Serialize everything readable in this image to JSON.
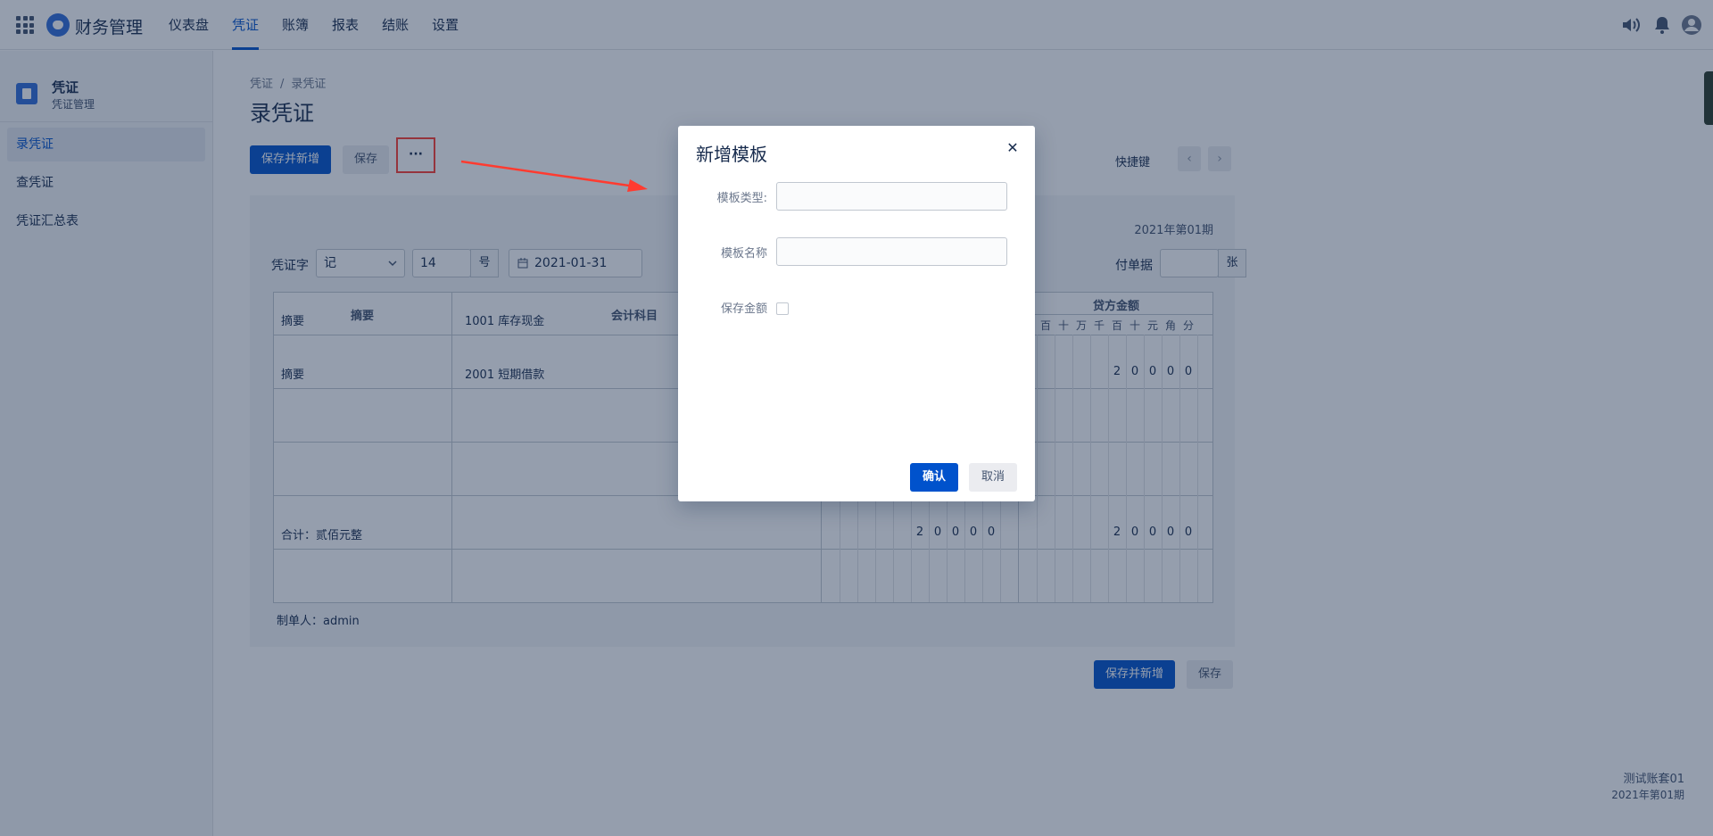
{
  "app": {
    "name": "财务管理"
  },
  "nav": {
    "items": [
      "仪表盘",
      "凭证",
      "账簿",
      "报表",
      "结账",
      "设置"
    ],
    "active": "凭证"
  },
  "sidebar": {
    "title": "凭证",
    "subtitle": "凭证管理",
    "items": [
      "录凭证",
      "查凭证",
      "凭证汇总表"
    ],
    "active": "录凭证"
  },
  "breadcrumb": {
    "root": "凭证",
    "sep": "/",
    "current": "录凭证"
  },
  "page": {
    "title": "录凭证"
  },
  "toolbar": {
    "save_new": "保存并新增",
    "save": "保存",
    "more": "···",
    "shortcut": "快捷键",
    "prev": "‹",
    "next": "›"
  },
  "voucher": {
    "period": "2021年第01期",
    "word_label": "凭证字",
    "word_value": "记",
    "number_value": "14",
    "number_suffix": "号",
    "date_value": "2021-01-31",
    "attach_label": "付单据",
    "attach_suffix": "张",
    "headers": {
      "summary": "摘要",
      "account": "会计科目",
      "credit": "贷方金额"
    },
    "digit_units": [
      "千",
      "百",
      "十",
      "万",
      "千",
      "百",
      "十",
      "元",
      "角",
      "分"
    ],
    "rows": [
      {
        "summary": "摘要",
        "account": "1001 库存现金",
        "debit": "",
        "credit": ""
      },
      {
        "summary": "摘要",
        "account": "2001 短期借款",
        "debit": "",
        "credit": "20000"
      },
      {
        "summary": "",
        "account": "",
        "debit": "",
        "credit": ""
      },
      {
        "summary": "",
        "account": "",
        "debit": "",
        "credit": ""
      }
    ],
    "total_label": "合计：贰佰元整",
    "total_debit": "20000",
    "total_credit": "20000",
    "maker": "制单人：admin"
  },
  "bottom": {
    "save_new": "保存并新增",
    "save": "保存"
  },
  "footer": {
    "account_set": "测试账套01",
    "period": "2021年第01期"
  },
  "modal": {
    "title": "新增模板",
    "close": "✕",
    "type_label": "模板类型:",
    "type_value": "",
    "name_label": "模板名称",
    "name_value": "",
    "amount_label": "保存金额",
    "amount_checked": false,
    "confirm": "确认",
    "cancel": "取消"
  },
  "colors": {
    "primary": "#0052cc",
    "highlight": "#ff3b30",
    "overlay": "rgba(23,43,77,0.46)"
  }
}
